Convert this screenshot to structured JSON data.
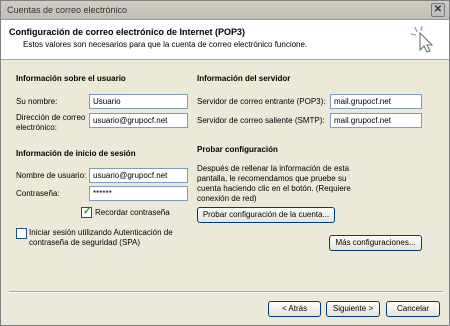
{
  "window": {
    "title": "Cuentas de correo electrónico",
    "close_label": "✕"
  },
  "header": {
    "title": "Configuración de correo electrónico de Internet (POP3)",
    "subtitle": "Estos valores son necesarios para que la cuenta de correo electrónico funcione."
  },
  "user_info": {
    "section": "Información sobre el usuario",
    "name_label": "Su nombre:",
    "name_value": "Usuario",
    "email_label": "Dirección de correo electrónico:",
    "email_value": "usuario@grupocf.net"
  },
  "server_info": {
    "section": "Información del servidor",
    "incoming_label": "Servidor de correo entrante (POP3):",
    "incoming_value": "mail.grupocf.net",
    "outgoing_label": "Servidor de correo saliente (SMTP):",
    "outgoing_value": "mail.grupocf.net"
  },
  "logon_info": {
    "section": "Información de inicio de sesión",
    "username_label": "Nombre de usuario:",
    "username_value": "usuario@grupocf.net",
    "password_label": "Contraseña:",
    "password_value": "******",
    "remember_label": "Recordar contraseña",
    "remember_checked": true,
    "spa_label": "Iniciar sesión utilizando Autenticación de contraseña de seguridad (SPA)",
    "spa_checked": false
  },
  "test": {
    "section": "Probar configuración",
    "description": "Después de rellenar la información de esta pantalla, le recomendamos que pruebe su cuenta haciendo clic en el botón. (Requiere conexión de red)",
    "test_button": "Probar configuración de la cuenta...",
    "more_button": "Más configuraciones..."
  },
  "footer": {
    "back_button": "< Atrás",
    "next_button": "Siguiente >",
    "cancel_button": "Cancelar"
  }
}
